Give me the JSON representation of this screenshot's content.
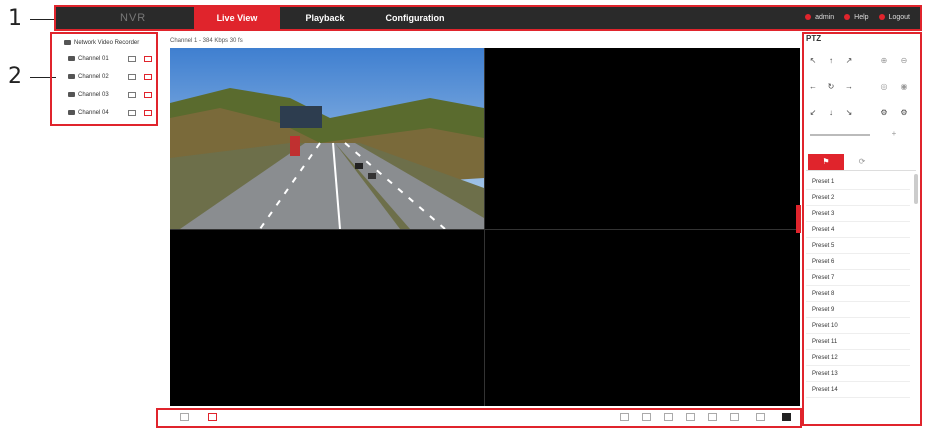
{
  "callouts": [
    "1",
    "2"
  ],
  "topbar": {
    "logo": "NVR",
    "nav": [
      {
        "label": "Live View",
        "active": true
      },
      {
        "label": "Playback",
        "active": false
      },
      {
        "label": "Configuration",
        "active": false
      }
    ],
    "user_label": "admin",
    "help_label": "Help",
    "logout_label": "Logout"
  },
  "device_tree": {
    "root_label": "Network Video Recorder",
    "channels": [
      "Channel 01",
      "Channel 02",
      "Channel 03",
      "Channel 04"
    ]
  },
  "live": {
    "channel_info": "Channel 1 - 384 Kbps 30 fs"
  },
  "ptz": {
    "title": "PTZ",
    "presets": [
      "Preset 1",
      "Preset 2",
      "Preset 3",
      "Preset 4",
      "Preset 5",
      "Preset 6",
      "Preset 7",
      "Preset 8",
      "Preset 9",
      "Preset 10",
      "Preset 11",
      "Preset 12",
      "Preset 13",
      "Preset 14"
    ]
  },
  "colors": {
    "accent": "#e0242c",
    "topbar": "#2a2a2a"
  }
}
